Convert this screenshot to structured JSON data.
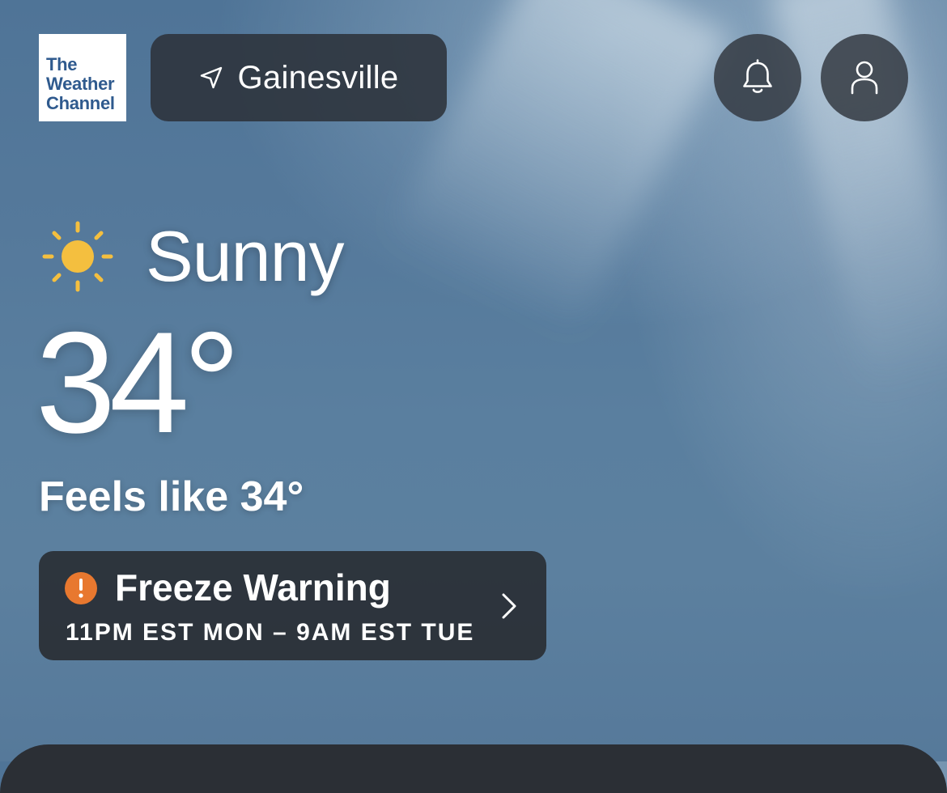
{
  "app": {
    "logo": [
      "The",
      "Weather",
      "Channel"
    ]
  },
  "header": {
    "location_label": "Gainesville",
    "location_icon": "location-arrow-icon",
    "notifications_icon": "bell-icon",
    "profile_icon": "user-icon"
  },
  "current": {
    "condition_icon": "sun-icon",
    "condition": "Sunny",
    "temperature": "34°",
    "feels_like": "Feels like 34°"
  },
  "alert": {
    "icon": "exclamation-icon",
    "title": "Freeze Warning",
    "time_range": "11PM EST MON – 9AM EST TUE",
    "color": "#e8782f"
  },
  "colors": {
    "sun": "#f4bf3f",
    "button_bg": "#2c323a"
  }
}
